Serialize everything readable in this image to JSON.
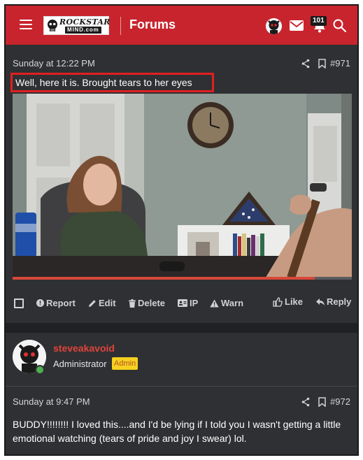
{
  "header": {
    "logo_top": "ROCKSTAR",
    "logo_bottom": "MIND.com",
    "title": "Forums",
    "notification_count": "101",
    "icons": [
      "menu-icon",
      "avatar",
      "mail-icon",
      "bell-icon",
      "search-icon"
    ]
  },
  "post1": {
    "date": "Sunday at 12:22 PM",
    "number": "#971",
    "text": "Well, here it is. Brought tears to her eyes",
    "video_progress": 0.89,
    "actions": {
      "report": "Report",
      "edit": "Edit",
      "delete": "Delete",
      "ip": "IP",
      "warn": "Warn",
      "like": "Like",
      "reply": "Reply"
    }
  },
  "user": {
    "name": "steveakavoid",
    "role": "Administrator",
    "badge": "Admin"
  },
  "post2": {
    "date": "Sunday at 9:47 PM",
    "number": "#972",
    "text": "BUDDY!!!!!!!! I loved this....and I'd be lying if I told you I wasn't getting a little emotional watching (tears of pride and joy I swear) lol."
  },
  "colors": {
    "header_red": "#c8242e",
    "background": "#2f3033",
    "username_red": "#e0443b",
    "badge_yellow": "#f6d11f",
    "highlight_red": "#e0201f"
  }
}
